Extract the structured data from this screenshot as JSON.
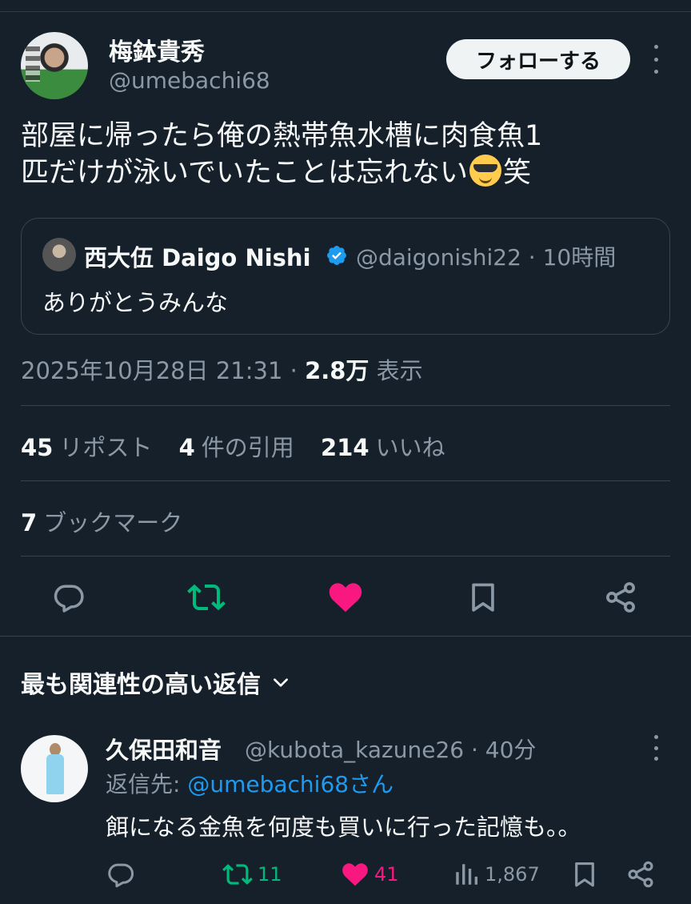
{
  "author": {
    "name": "梅鉢貴秀",
    "handle": "@umebachi68",
    "follow_label": "フォローする"
  },
  "tweet": {
    "text_line1": "部屋に帰ったら俺の熱帯魚水槽に肉食魚1",
    "text_line2_a": "匹だけが泳いでいたことは忘れない",
    "emoji": "smiling-face-with-sunglasses",
    "text_line2_b": "笑"
  },
  "quote": {
    "name": "西大伍 Daigo Nishi",
    "handle_time": "@daigonishi22 · 10時間",
    "text": "ありがとうみんな"
  },
  "meta": {
    "datetime": "2025年10月28日 21:31 · ",
    "views": "2.8万",
    "views_label": " 表示"
  },
  "stats": {
    "reposts": "45",
    "reposts_label": "リポスト",
    "quotes": "4",
    "quotes_label": "件の引用",
    "likes": "214",
    "likes_label": "いいね",
    "bookmarks": "7",
    "bookmarks_label": "ブックマーク"
  },
  "colors": {
    "background": "#15202b",
    "repost": "#00ba7c",
    "like": "#f91880",
    "link": "#1d9bf0",
    "verified": "#1d9bf0"
  },
  "replies_header": "最も関連性の高い返信",
  "reply": {
    "name": "久保田和音",
    "handle_time": "@kubota_kazune26 · 40分",
    "reply_prefix": "返信先: ",
    "reply_to": "@umebachi68さん",
    "text": "餌になる金魚を何度も買いに行った記憶も。。",
    "reposts": "11",
    "likes": "41",
    "views": "1,867"
  }
}
